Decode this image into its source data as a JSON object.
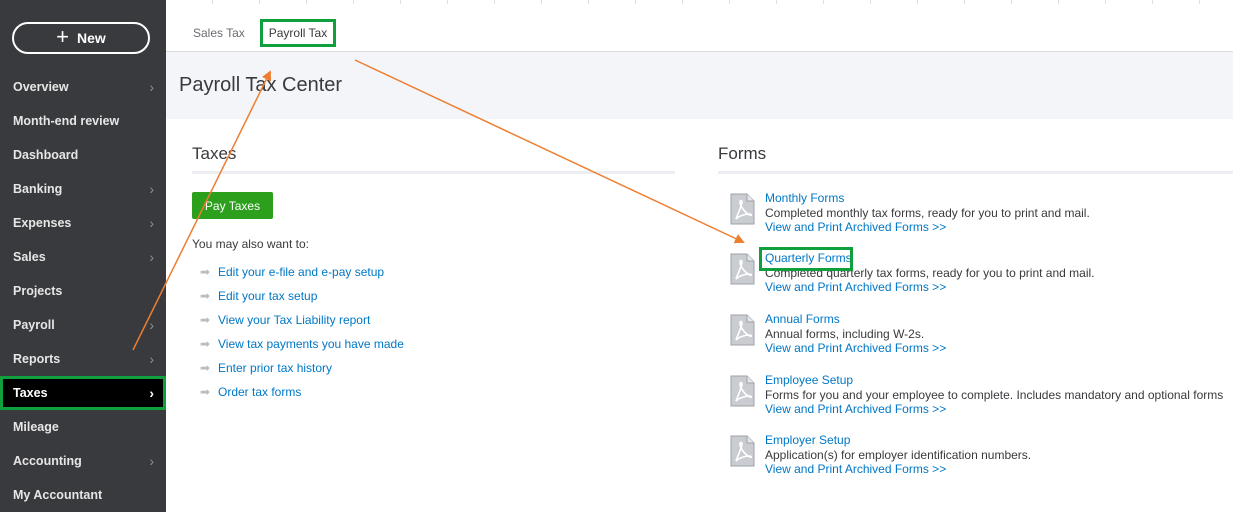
{
  "sidebar": {
    "new_label": "New",
    "items": [
      {
        "label": "Overview",
        "chevron": true
      },
      {
        "label": "Month-end review",
        "chevron": false
      },
      {
        "label": "Dashboard",
        "chevron": false
      },
      {
        "label": "Banking",
        "chevron": true
      },
      {
        "label": "Expenses",
        "chevron": true
      },
      {
        "label": "Sales",
        "chevron": true
      },
      {
        "label": "Projects",
        "chevron": false
      },
      {
        "label": "Payroll",
        "chevron": true
      },
      {
        "label": "Reports",
        "chevron": true
      },
      {
        "label": "Taxes",
        "chevron": true,
        "active": true
      },
      {
        "label": "Mileage",
        "chevron": false
      },
      {
        "label": "Accounting",
        "chevron": true
      },
      {
        "label": "My Accountant",
        "chevron": false
      }
    ]
  },
  "tabs": {
    "sales_tax": "Sales Tax",
    "payroll_tax": "Payroll Tax"
  },
  "page": {
    "title": "Payroll Tax Center"
  },
  "taxes": {
    "title": "Taxes",
    "pay_button": "Pay Taxes",
    "also_label": "You may also want to:",
    "links": [
      "Edit your e-file and e-pay setup",
      "Edit your tax setup",
      "View your Tax Liability report",
      "View tax payments you have made",
      "Enter prior tax history",
      "Order tax forms"
    ]
  },
  "forms": {
    "title": "Forms",
    "items": [
      {
        "title": "Monthly Forms",
        "desc": "Completed monthly tax forms, ready for you to print and mail.",
        "archive": "View and Print Archived Forms >>"
      },
      {
        "title": "Quarterly Forms",
        "desc": "Completed quarterly tax forms, ready for you to print and mail.",
        "archive": "View and Print Archived Forms >>",
        "highlighted": true
      },
      {
        "title": "Annual Forms",
        "desc": "Annual forms, including W-2s.",
        "archive": "View and Print Archived Forms >>"
      },
      {
        "title": "Employee Setup",
        "desc": "Forms for you and your employee to complete. Includes mandatory and optional forms",
        "archive": "View and Print Archived Forms >>"
      },
      {
        "title": "Employer Setup",
        "desc": "Application(s) for employer identification numbers.",
        "archive": "View and Print Archived Forms >>"
      }
    ]
  },
  "colors": {
    "sidebar_bg": "#393a3d",
    "highlight": "#0f9f3c",
    "button_green": "#2ca01c",
    "link_blue": "#0077c5",
    "annotation_arrow": "#ed7d31"
  },
  "icons": {
    "new": "plus-icon",
    "chevron": "chevron-right-icon",
    "link_arrow": "arrow-right-icon",
    "form": "pdf-document-icon"
  }
}
